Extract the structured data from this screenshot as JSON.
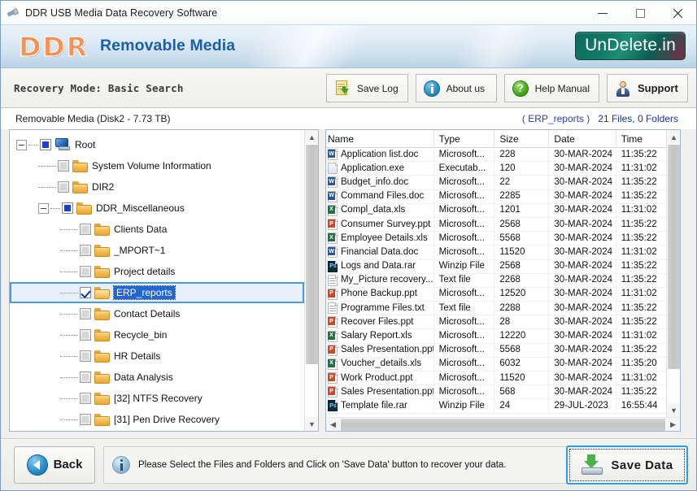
{
  "window": {
    "title": "DDR USB Media Data Recovery Software",
    "icon": "usb-drive-icon",
    "minimize_label": "–",
    "maximize_label": "□",
    "close_label": "✕"
  },
  "banner": {
    "logo_text": "DDR",
    "product_title": "Removable Media",
    "badge_text": "UnDelete.in",
    "badge_color": "#0f6b5e"
  },
  "toolbar": {
    "recovery_mode": "Recovery Mode: Basic Search",
    "buttons": [
      {
        "label": "Save Log",
        "icon": "save-log-icon"
      },
      {
        "label": "About us",
        "icon": "info-circle-icon"
      },
      {
        "label": "Help Manual",
        "icon": "question-circle-icon"
      },
      {
        "label": "Support",
        "icon": "person-icon"
      }
    ]
  },
  "driveinfo": {
    "media": "Removable Media (Disk2 - 7.73 TB)",
    "folder_context": "( ERP_reports )",
    "counts": "21 Files, 0 Folders"
  },
  "tree": {
    "nodes": [
      {
        "label": "Root",
        "depth": 0,
        "icon": "drive-icon",
        "check": "filled",
        "expander": "minus",
        "selected": false
      },
      {
        "label": "System Volume Information",
        "depth": 1,
        "icon": "folder-icon",
        "check": "grey",
        "expander": "none",
        "selected": false
      },
      {
        "label": "DIR2",
        "depth": 1,
        "icon": "folder-icon",
        "check": "grey",
        "expander": "none",
        "selected": false
      },
      {
        "label": "DDR_Miscellaneous",
        "depth": 1,
        "icon": "folder-icon",
        "check": "filled",
        "expander": "minus",
        "selected": false
      },
      {
        "label": "Clients Data",
        "depth": 2,
        "icon": "folder-icon",
        "check": "grey",
        "expander": "none",
        "selected": false
      },
      {
        "label": "_MPORT~1",
        "depth": 2,
        "icon": "folder-icon",
        "check": "grey",
        "expander": "none",
        "selected": false
      },
      {
        "label": "Project details",
        "depth": 2,
        "icon": "folder-icon",
        "check": "grey",
        "expander": "none",
        "selected": false
      },
      {
        "label": "ERP_reports",
        "depth": 2,
        "icon": "folder-open-icon",
        "check": "checked",
        "expander": "none",
        "selected": true
      },
      {
        "label": "Contact Details",
        "depth": 2,
        "icon": "folder-icon",
        "check": "grey",
        "expander": "none",
        "selected": false
      },
      {
        "label": "Recycle_bin",
        "depth": 2,
        "icon": "folder-icon",
        "check": "grey",
        "expander": "none",
        "selected": false
      },
      {
        "label": "HR Details",
        "depth": 2,
        "icon": "folder-icon",
        "check": "grey",
        "expander": "none",
        "selected": false
      },
      {
        "label": "Data Analysis",
        "depth": 2,
        "icon": "folder-icon",
        "check": "grey",
        "expander": "none",
        "selected": false
      },
      {
        "label": "[32] NTFS Recovery",
        "depth": 2,
        "icon": "folder-icon",
        "check": "grey",
        "expander": "none",
        "selected": false
      },
      {
        "label": "[31] Pen Drive Recovery",
        "depth": 2,
        "icon": "folder-icon",
        "check": "grey",
        "expander": "none",
        "selected": false
      }
    ]
  },
  "filelist": {
    "columns": [
      "Name",
      "Type",
      "Size",
      "Date",
      "Time"
    ],
    "rows": [
      {
        "name": "Application list.doc",
        "kind": "doc",
        "badge": "W",
        "type": "Microsoft...",
        "size": "228",
        "date": "30-MAR-2024",
        "time": "11:35:22"
      },
      {
        "name": "Application.exe",
        "kind": "exe",
        "badge": "",
        "type": "Executab...",
        "size": "120",
        "date": "30-MAR-2024",
        "time": "11:31:02"
      },
      {
        "name": "Budget_info.doc",
        "kind": "doc",
        "badge": "W",
        "type": "Microsoft...",
        "size": "22",
        "date": "30-MAR-2024",
        "time": "11:35:22"
      },
      {
        "name": "Command Files.doc",
        "kind": "doc",
        "badge": "W",
        "type": "Microsoft...",
        "size": "2285",
        "date": "30-MAR-2024",
        "time": "11:35:22"
      },
      {
        "name": "Compl_data.xls",
        "kind": "xls",
        "badge": "X",
        "type": "Microsoft...",
        "size": "1201",
        "date": "30-MAR-2024",
        "time": "11:31:02"
      },
      {
        "name": "Consumer Survey.ppt",
        "kind": "ppt",
        "badge": "P",
        "type": "Microsoft...",
        "size": "2568",
        "date": "30-MAR-2024",
        "time": "11:35:22"
      },
      {
        "name": "Employee Details.xls",
        "kind": "xls",
        "badge": "X",
        "type": "Microsoft...",
        "size": "5568",
        "date": "30-MAR-2024",
        "time": "11:35:22"
      },
      {
        "name": "Financial Data.doc",
        "kind": "doc",
        "badge": "W",
        "type": "Microsoft...",
        "size": "11520",
        "date": "30-MAR-2024",
        "time": "11:31:02"
      },
      {
        "name": "Logs and Data.rar",
        "kind": "rar",
        "badge": "Ps",
        "type": "Winzip File",
        "size": "2568",
        "date": "30-MAR-2024",
        "time": "11:35:22"
      },
      {
        "name": "My_Picture recovery....",
        "kind": "txt",
        "badge": "",
        "type": "Text file",
        "size": "2268",
        "date": "30-MAR-2024",
        "time": "11:35:22"
      },
      {
        "name": "Phone Backup.ppt",
        "kind": "ppt",
        "badge": "P",
        "type": "Microsoft...",
        "size": "12520",
        "date": "30-MAR-2024",
        "time": "11:31:02"
      },
      {
        "name": "Programme Files.txt",
        "kind": "txt",
        "badge": "",
        "type": "Text file",
        "size": "2288",
        "date": "30-MAR-2024",
        "time": "11:35:22"
      },
      {
        "name": "Recover Files.ppt",
        "kind": "ppt",
        "badge": "P",
        "type": "Microsoft...",
        "size": "28",
        "date": "30-MAR-2024",
        "time": "11:35:22"
      },
      {
        "name": "Salary Report.xls",
        "kind": "xls",
        "badge": "X",
        "type": "Microsoft...",
        "size": "12220",
        "date": "30-MAR-2024",
        "time": "11:31:02"
      },
      {
        "name": "Sales Presentation.ppt",
        "kind": "ppt",
        "badge": "P",
        "type": "Microsoft...",
        "size": "5568",
        "date": "30-MAR-2024",
        "time": "11:35:22"
      },
      {
        "name": "Voucher_details.xls",
        "kind": "xls",
        "badge": "X",
        "type": "Microsoft...",
        "size": "6032",
        "date": "30-MAR-2024",
        "time": "11:35:20"
      },
      {
        "name": "Work Product.ppt",
        "kind": "ppt",
        "badge": "P",
        "type": "Microsoft...",
        "size": "11520",
        "date": "30-MAR-2024",
        "time": "11:31:02"
      },
      {
        "name": "Sales Presentation.ppt",
        "kind": "ppt",
        "badge": "P",
        "type": "Microsoft...",
        "size": "568",
        "date": "30-MAR-2024",
        "time": "11:35:22"
      },
      {
        "name": "Template file.rar",
        "kind": "rar",
        "badge": "Ps",
        "type": "Winzip File",
        "size": "24",
        "date": "29-JUL-2023",
        "time": "16:55:44"
      }
    ]
  },
  "bottom": {
    "back_label": "Back",
    "message": "Please Select the Files and Folders and Click on 'Save Data' button to recover your data.",
    "save_label": "Save  Data"
  }
}
